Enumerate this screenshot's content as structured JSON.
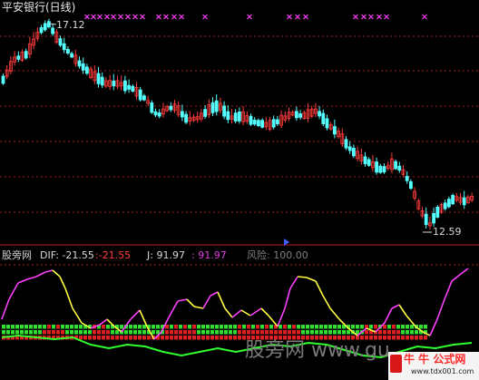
{
  "price_pane": {
    "title": "平安银行(日线)",
    "high_label": "17.12",
    "low_label": "12.59",
    "colors": {
      "up": "#ff3c3c",
      "down": "#54ffff",
      "grid": "#a02020",
      "signal": "#ff40ff"
    }
  },
  "indicator_pane": {
    "name": "股旁网",
    "dif_label": "DIF:",
    "dif_value": "-21.55",
    "dif_value2": ":-21.55",
    "j_label": "J:",
    "j_value": "91.97",
    "j_value2": ": 91.97",
    "risk_label": "风险: 100.00",
    "colors": {
      "j_rising": "#ff40ff",
      "j_falling": "#ffff40",
      "dif": "#30ff30",
      "bar_green": "#30e030",
      "bar_red": "#e02020"
    }
  },
  "watermarks": {
    "center": "股旁网 www.gu",
    "logo_text": "牛 牛 公式网",
    "logo_url": "www.tdx001.com"
  }
}
